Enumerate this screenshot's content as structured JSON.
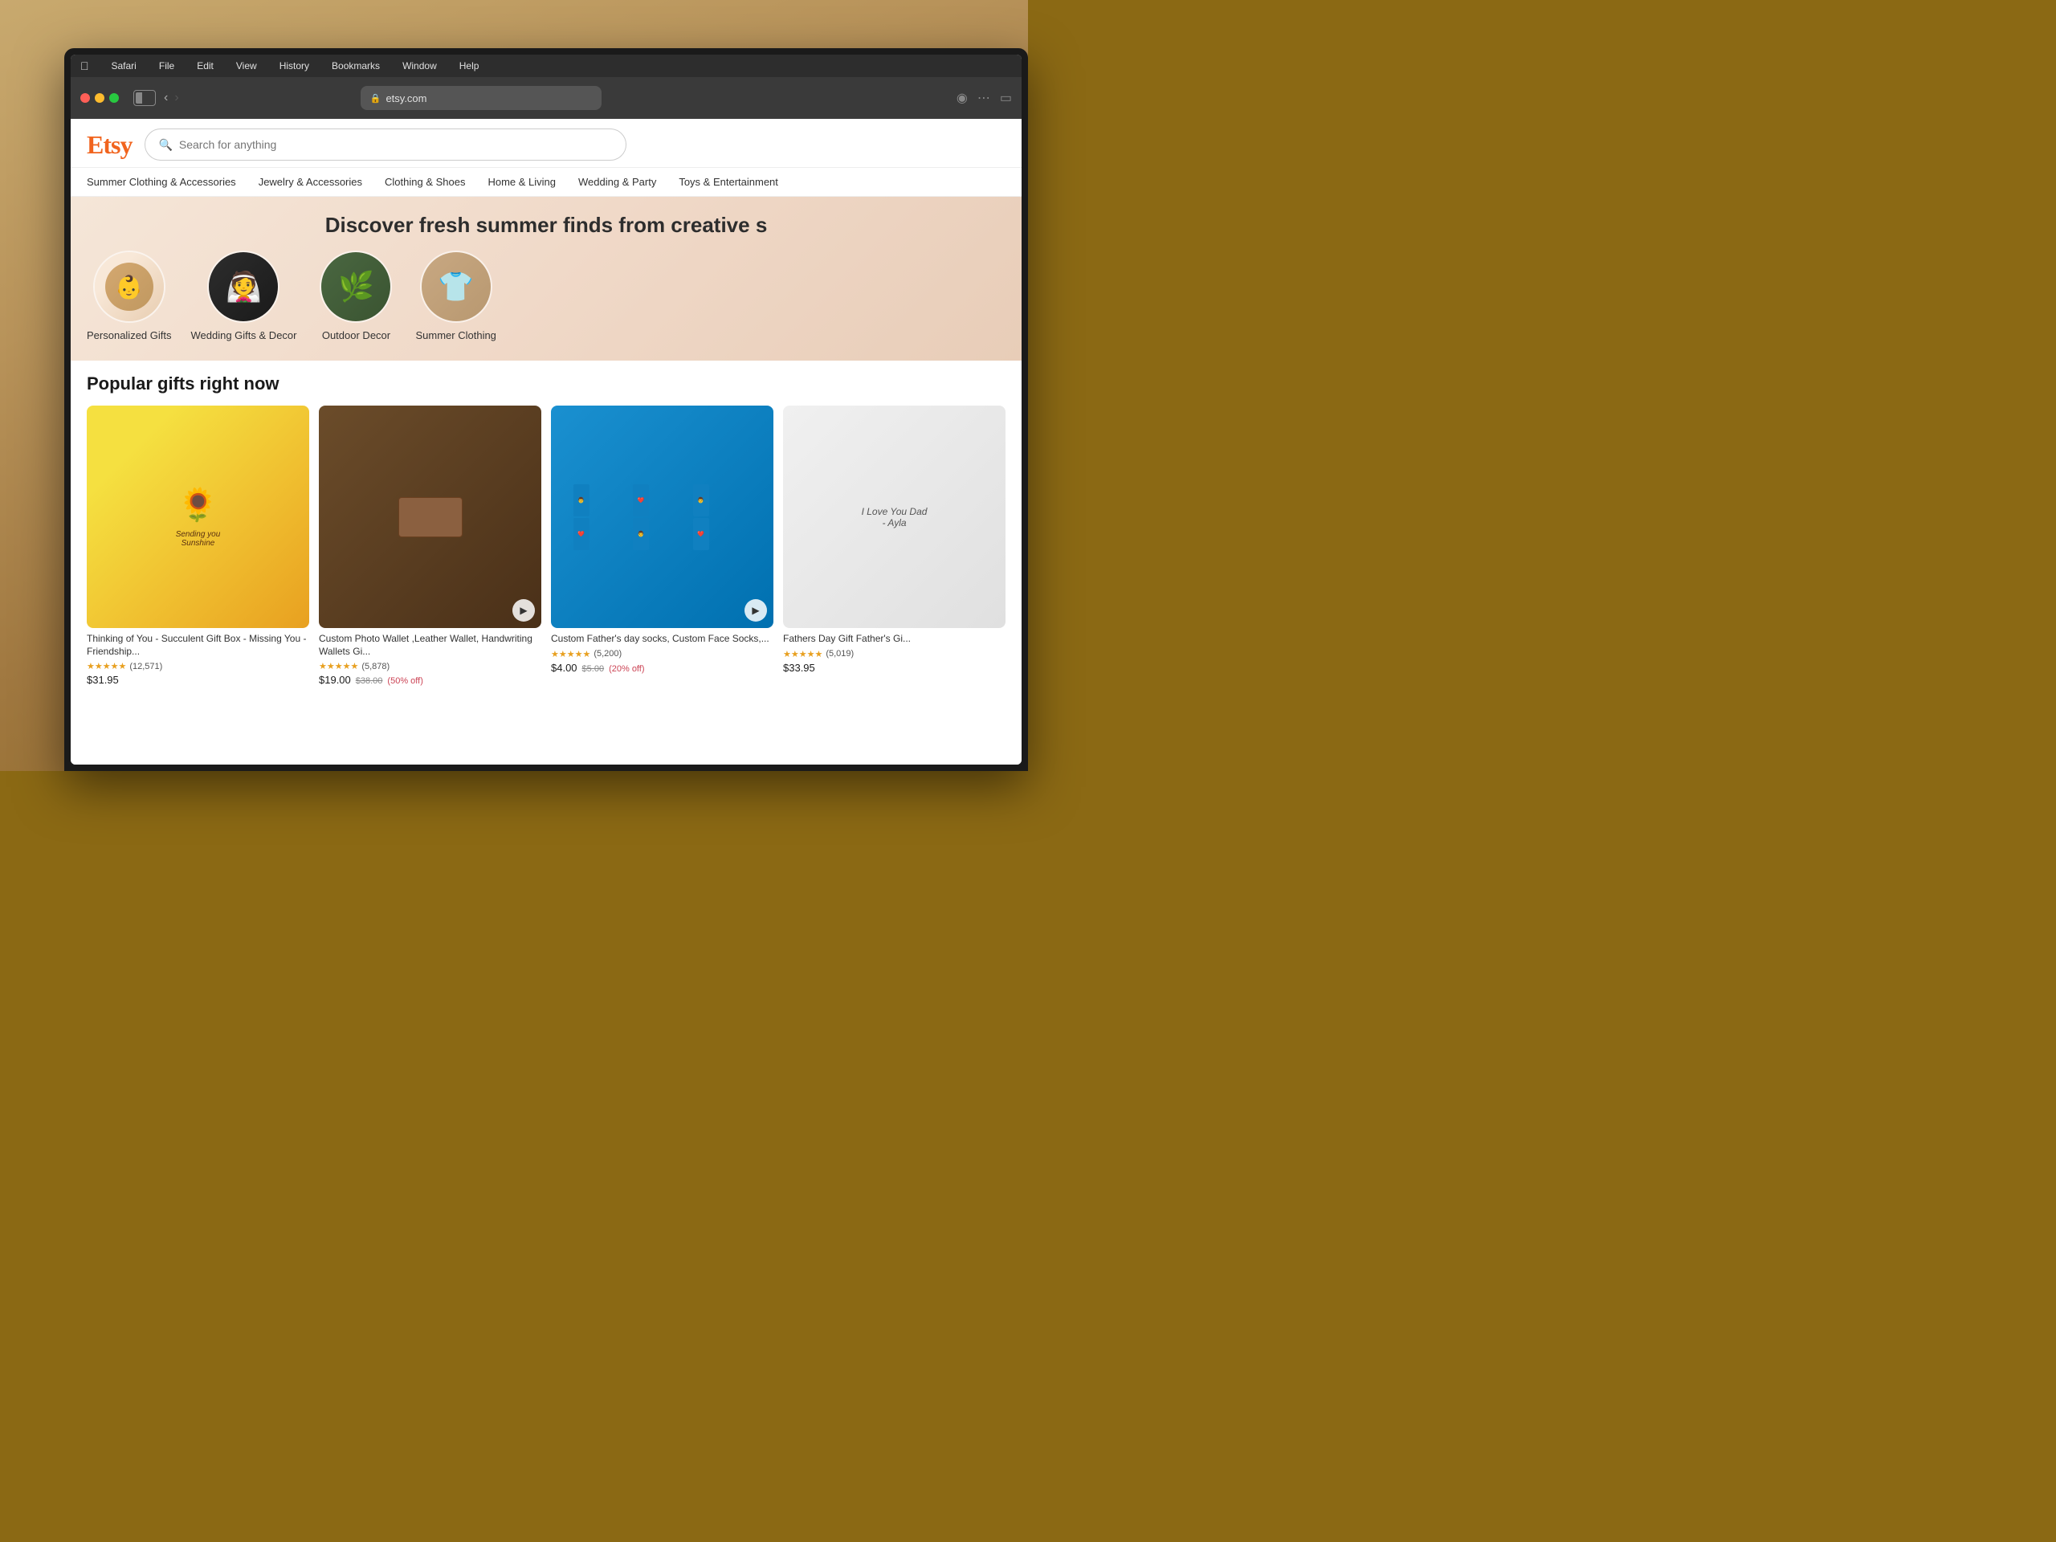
{
  "scene": {
    "bg_description": "wooden table with laptop"
  },
  "browser": {
    "type": "Safari",
    "menu_items": [
      "Safari",
      "File",
      "Edit",
      "View",
      "History",
      "Bookmarks",
      "Window",
      "Help"
    ],
    "address": "etsy.com",
    "back_enabled": true,
    "forward_enabled": false
  },
  "etsy": {
    "logo": "Etsy",
    "search_placeholder": "Search for anything",
    "hero_text": "Discover fresh summer finds from creative s",
    "nav_items": [
      "Summer Clothing & Accessories",
      "Jewelry & Accessories",
      "Clothing & Shoes",
      "Home & Living",
      "Wedding & Party",
      "Toys & Entertainment"
    ],
    "categories": [
      {
        "label": "Personalized Gifts",
        "emoji": "👶",
        "style": "personalized"
      },
      {
        "label": "Wedding Gifts & Decor",
        "emoji": "💒",
        "style": "wedding"
      },
      {
        "label": "Outdoor Decor",
        "emoji": "🌿",
        "style": "outdoor"
      },
      {
        "label": "Summer Clothing",
        "emoji": "👕",
        "style": "summer"
      }
    ],
    "popular_section": {
      "title": "Popular gifts right now"
    },
    "products": [
      {
        "title": "Thinking of You - Succulent Gift Box - Missing You - Friendship...",
        "stars": "★★★★★",
        "rating": "4.8",
        "count": "(12,571)",
        "price": "$31.95",
        "original_price": "",
        "discount": "",
        "has_video": false,
        "style": "sunshine"
      },
      {
        "title": "Custom Photo Wallet ,Leather Wallet, Handwriting Wallets Gi...",
        "stars": "★★★★★",
        "rating": "4.9",
        "count": "(5,878)",
        "price": "$19.00",
        "original_price": "$38.00",
        "discount": "(50% off)",
        "has_video": true,
        "style": "wallet"
      },
      {
        "title": "Custom Father's day socks, Custom Face Socks,...",
        "stars": "★★★★★",
        "rating": "4.8",
        "count": "(5,200)",
        "price": "$4.00",
        "original_price": "$5.00",
        "discount": "(20% off)",
        "has_video": true,
        "style": "socks"
      },
      {
        "title": "Fathers Day Gift Father's Gi...",
        "stars": "★★★★★",
        "rating": "4.9",
        "count": "(5,019)",
        "price": "$33.95",
        "original_price": "",
        "discount": "",
        "has_video": false,
        "style": "dads"
      }
    ]
  }
}
